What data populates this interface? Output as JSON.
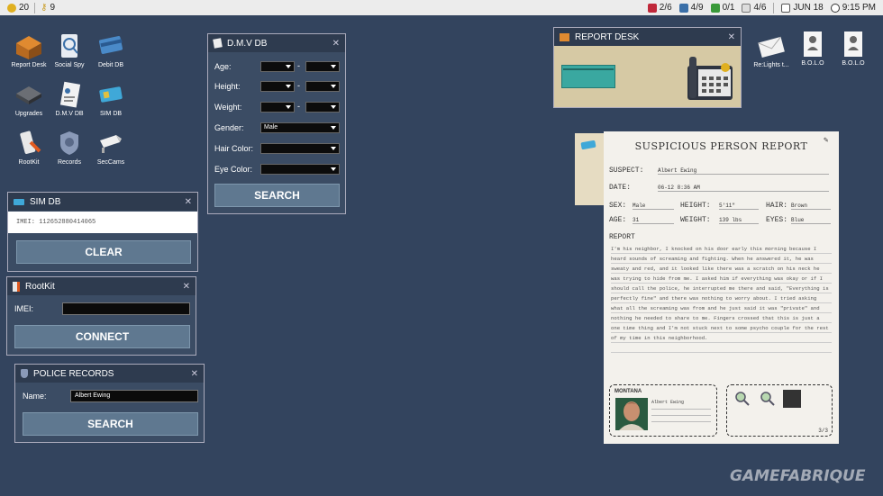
{
  "topbar": {
    "coins": "20",
    "keys": "9",
    "stat1": "2/6",
    "stat2": "4/9",
    "stat3": "0/1",
    "stat4": "4/6",
    "date": "JUN 18",
    "time": "9:15 PM"
  },
  "desktop_icons": [
    "Report Desk",
    "Social Spy",
    "Debit DB",
    "Upgrades",
    "D.M.V DB",
    "SIM DB",
    "RootKit",
    "Records",
    "SecCams"
  ],
  "right_icons": [
    "Re:Lights t...",
    "B.O.L.O",
    "B.O.L.O"
  ],
  "dmv": {
    "title": "D.M.V DB",
    "age_label": "Age:",
    "height_label": "Height:",
    "weight_label": "Weight:",
    "gender_label": "Gender:",
    "gender_value": "Male",
    "hair_label": "Hair Color:",
    "eye_label": "Eye Color:",
    "dash": "-",
    "search": "SEARCH"
  },
  "simdb": {
    "title": "SIM DB",
    "imei_value": "IMEI: 112652880414065",
    "clear": "CLEAR"
  },
  "rootkit": {
    "title": "RootKit",
    "imei_label": "IMEI:",
    "connect": "CONNECT"
  },
  "police": {
    "title": "POLICE RECORDS",
    "name_label": "Name:",
    "name_value": "Albert Ewing",
    "search": "SEARCH"
  },
  "report_desk": {
    "title": "REPORT DESK"
  },
  "report": {
    "title": "SUSPICIOUS PERSON REPORT",
    "suspect_label": "SUSPECT:",
    "suspect": "Albert Ewing",
    "date_label": "DATE:",
    "date": "06-12 8:36 AM",
    "sex_label": "SEX:",
    "sex": "Male",
    "height_label": "HEIGHT:",
    "height": "5'11\"",
    "hair_label": "HAIR:",
    "hair": "Brown",
    "age_label": "AGE:",
    "age": "31",
    "weight_label": "WEIGHT:",
    "weight": "139 lbs",
    "eyes_label": "EYES:",
    "eyes": "Blue",
    "report_label": "REPORT",
    "text": "I'm his neighbor, I knocked on his door early this morning because I heard sounds of screaming and fighting. When he answered it, he was sweaty and red, and it looked like there was a scratch on his neck he was trying to hide from me. I asked him if everything was okay or if I should call the police, he interrupted me there and said, \"Everything is perfectly fine\" and there was nothing to worry about. I tried asking what all the screaming was from and he just said it was \"private\" and nothing he needed to share to me. Fingers crossed that this is just a one time thing and I'm not stuck next to some psycho couple for the rest of my time in this neighborhood.",
    "license_state": "MONTANA",
    "license_name": "Albert Ewing",
    "page": "3/3"
  },
  "watermark": "GAMEFABRIQUE"
}
